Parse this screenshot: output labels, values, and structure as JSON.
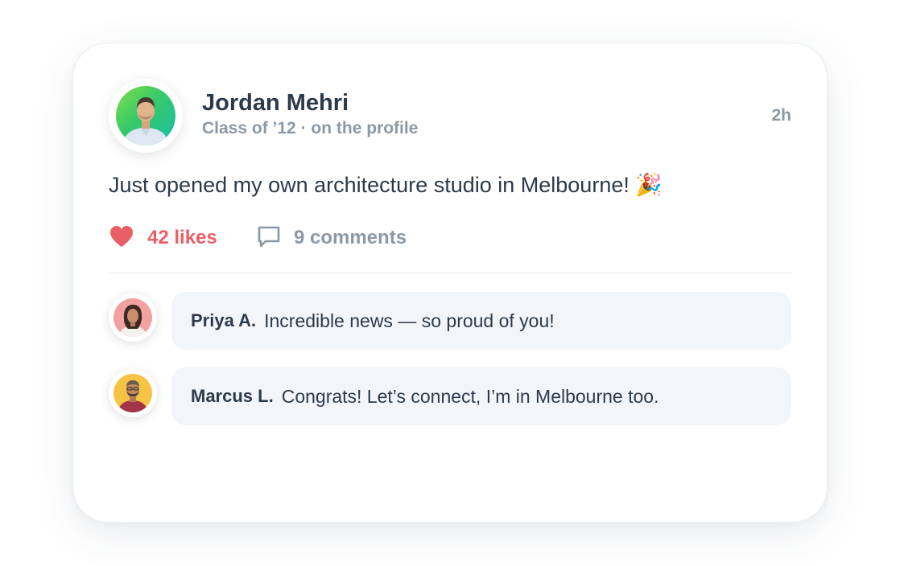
{
  "post": {
    "author": {
      "name": "Jordan Mehri",
      "meta": "Class of ’12 · on the profile"
    },
    "timestamp": "2h",
    "text": "Just opened my own architecture studio in Melbourne! 🎉",
    "likes_label": "42 likes",
    "comments_label": "9 comments"
  },
  "comments": [
    {
      "author": "Priya A.",
      "text": "Incredible news — so proud of you!"
    },
    {
      "author": "Marcus L.",
      "text": "Congrats! Let’s connect, I’m in Melbourne too."
    }
  ],
  "icons": {
    "like": "heart-icon",
    "comment": "speech-bubble-icon"
  },
  "colors": {
    "like_accent": "#ea5f66",
    "text_primary": "#2c3a4b",
    "text_muted": "#8d98a6",
    "bubble_bg": "#f2f5f9"
  }
}
